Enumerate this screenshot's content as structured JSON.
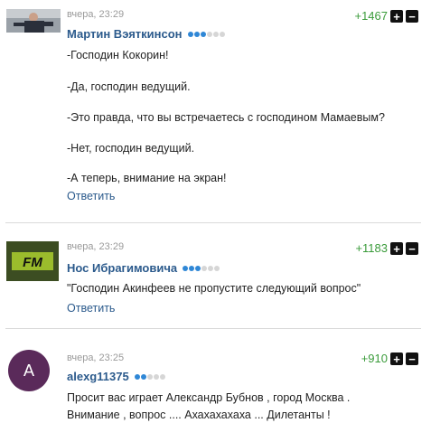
{
  "comments": [
    {
      "time": "вчера, 23:29",
      "author": "Мартин Вэяткинсон",
      "rank_filled": 3,
      "rank_total": 6,
      "rating": "+1467",
      "lines": [
        "-Господин Кокорин!",
        "-Да, господин ведущий.",
        "-Это правда, что вы встречаетесь с господином Мамаевым?",
        "-Нет, господин ведущий.",
        "-А теперь, внимание на экран!"
      ],
      "reply_label": "Ответить"
    },
    {
      "time": "вчера, 23:29",
      "author": "Нос Ибрагимовича",
      "avatar_text": "FM",
      "rank_filled": 3,
      "rank_total": 6,
      "rating": "+1183",
      "lines": [
        "\"Господин Акинфеев не пропустите следующий вопрос\""
      ],
      "reply_label": "Ответить"
    },
    {
      "time": "вчера, 23:25",
      "author": "alexg11375",
      "avatar_text": "A",
      "rank_filled": 2,
      "rank_total": 5,
      "rating": "+910",
      "lines": [
        "Просит вас играет Александр Бубнов , город Москва .",
        "Внимание , вопрос .... Ахахахахаха ... Дилетанты !"
      ]
    }
  ],
  "vote": {
    "plus": "+",
    "minus": "−"
  },
  "colors": {
    "author": "#2b5a8c",
    "rating": "#3a9b3a",
    "rank_dot": "#2f87d6",
    "avatar3": "#5a2a5a"
  }
}
